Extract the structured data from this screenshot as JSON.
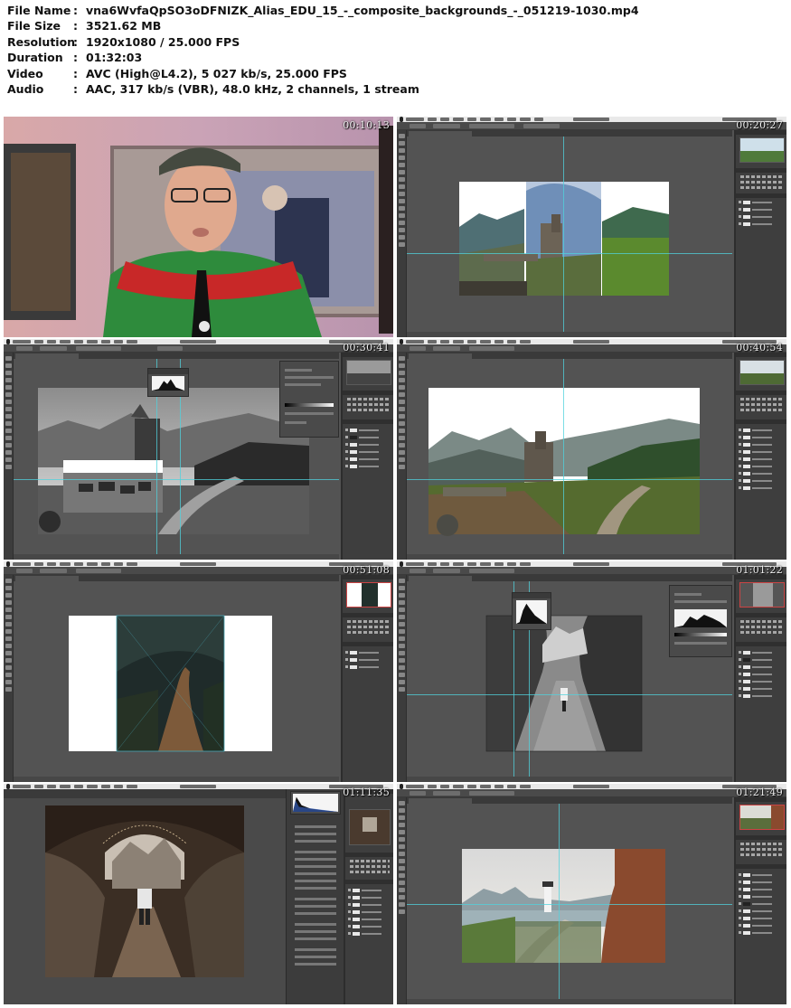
{
  "file_info": [
    {
      "key": "File Name",
      "value": "vna6WvfaQpSO3oDFNIZK_Alias_EDU_15_-_composite_backgrounds_-_051219-1030.mp4"
    },
    {
      "key": "File Size",
      "value": "3521.62 MB"
    },
    {
      "key": "Resolution",
      "value": "1920x1080 / 25.000 FPS"
    },
    {
      "key": "Duration",
      "value": "01:32:03"
    },
    {
      "key": "Video",
      "value": "AVC (High@L4.2), 5 027 kb/s, 25.000 FPS"
    },
    {
      "key": "Audio",
      "value": "AAC, 317 kb/s (VBR), 48.0 kHz, 2 channels, 1 stream"
    }
  ],
  "separator": ":",
  "thumbnails": [
    {
      "timestamp": "00:10:13",
      "scene": "presenter"
    },
    {
      "timestamp": "00:20:27",
      "scene": "photoshop-castle-panels"
    },
    {
      "timestamp": "00:30:41",
      "scene": "photoshop-bw-horses"
    },
    {
      "timestamp": "00:40:54",
      "scene": "photoshop-castle-composite"
    },
    {
      "timestamp": "00:51:08",
      "scene": "photoshop-forest-path"
    },
    {
      "timestamp": "01:01:22",
      "scene": "photoshop-bw-canyon"
    },
    {
      "timestamp": "01:11:35",
      "scene": "camera-raw-cave"
    },
    {
      "timestamp": "01:21:49",
      "scene": "photoshop-lighthouse"
    }
  ],
  "colors": {
    "photoshop_bg": "#535353",
    "panel_bg": "#3e3e3e",
    "guide": "#50d2dc",
    "timestamp_text": "#f2f2f2"
  }
}
